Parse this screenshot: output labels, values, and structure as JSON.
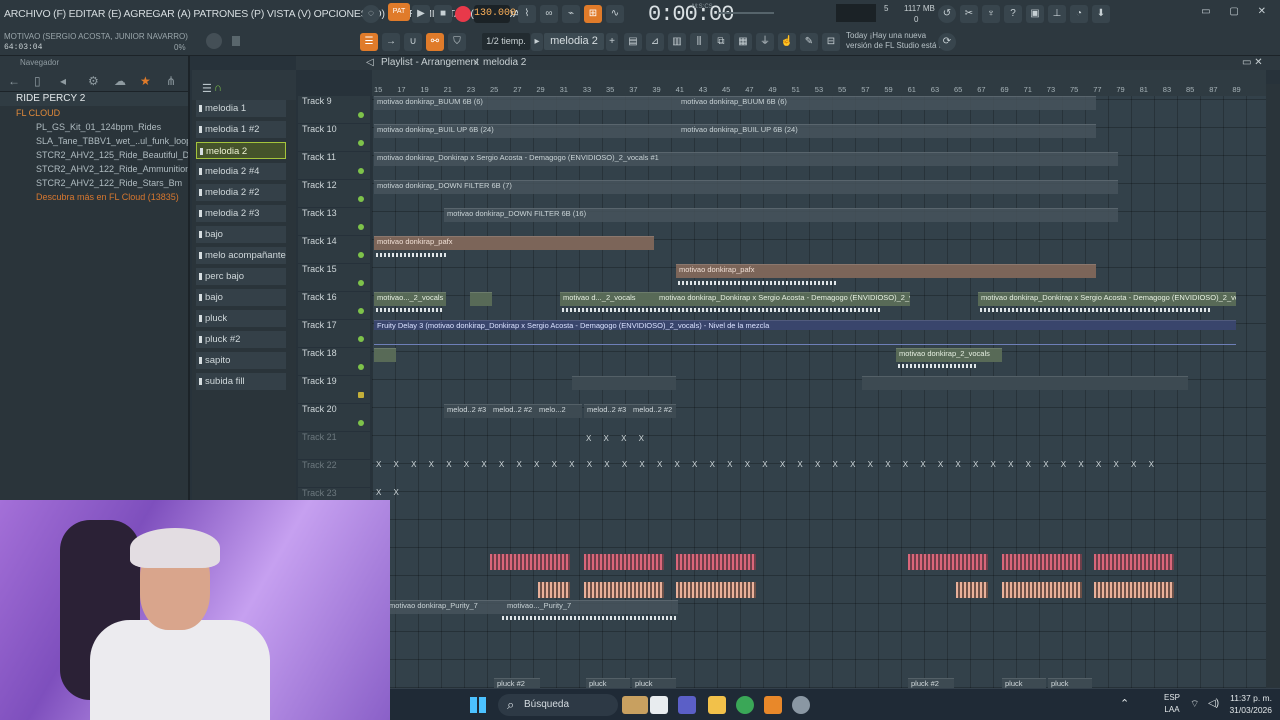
{
  "menu": {
    "items": "ARCHIVO (F) EDITAR (E) AGREGAR (A) PATRONES (P) VISTA (V) OPCIONES (O) HERRAMIENTAS (T) AYUDA"
  },
  "hint": "MOTIVAO (SERGIO ACOSTA, JUNIOR NAVARRO)",
  "position": "64:03:04",
  "percent": "0%",
  "transport": {
    "pat_label": "PAT",
    "bpm": "130.000",
    "clock": "0:00:00",
    "clock_unit": "M:S:CS"
  },
  "cpu": {
    "a": "5",
    "b": "1117 MB",
    "c": "0"
  },
  "toolbar": {
    "snap": "1/2 tiemp.",
    "pattern": "melodia 2"
  },
  "news": {
    "line1": "Today ¡Hay una nueva",
    "line2": "versión de FL Studio está d..."
  },
  "browser": {
    "title": "Navegador",
    "items": [
      {
        "label": "RIDE PERCY 2",
        "kind": "top"
      },
      {
        "label": "FL CLOUD",
        "kind": "folder"
      },
      {
        "label": "PL_GS_Kit_01_124bpm_Rides",
        "kind": "item"
      },
      {
        "label": "SLA_Tane_TBBV1_wet_..ul_funk_loop_riding",
        "kind": "item"
      },
      {
        "label": "STCR2_AHV2_125_Ride_Beautiful_D#m",
        "kind": "item"
      },
      {
        "label": "STCR2_AHV2_122_Ride_Ammunition_Cm",
        "kind": "item"
      },
      {
        "label": "STCR2_AHV2_122_Ride_Stars_Bm",
        "kind": "item"
      },
      {
        "label": "Descubra más en FL Cloud (13835)",
        "kind": "orange"
      }
    ]
  },
  "channels": [
    "melodia 1",
    "melodia 1 #2",
    "melodia 2",
    "melodia 2 #4",
    "melodia 2 #2",
    "melodia 2 #3",
    "bajo",
    "melo acompañante",
    "perc bajo",
    "bajo",
    "pluck",
    "pluck #2",
    "sapito",
    "subida fill"
  ],
  "playlist": {
    "title": "Playlist - Arrangement",
    "sep": "›",
    "pattern": "melodia 2"
  },
  "ruler": [
    "15",
    "17",
    "19",
    "21",
    "23",
    "25",
    "27",
    "29",
    "31",
    "33",
    "35",
    "37",
    "39",
    "41",
    "43",
    "45",
    "47",
    "49",
    "51",
    "53",
    "55",
    "57",
    "59",
    "61",
    "63",
    "65",
    "67",
    "69",
    "71",
    "73",
    "75",
    "77",
    "79",
    "81",
    "83",
    "85",
    "87",
    "89"
  ],
  "tracks": [
    "Track 9",
    "Track 10",
    "Track 11",
    "Track 12",
    "Track 13",
    "Track 14",
    "Track 15",
    "Track 16",
    "Track 17",
    "Track 18",
    "Track 19",
    "Track 20",
    "Track 21",
    "Track 22",
    "Track 23"
  ],
  "clips": {
    "c1": "motivao donkirap_BUUM 6B (6)",
    "c2": "motivao donkirap_BUUM 6B (6)",
    "c3": "motivao donkirap_BUIL UP 6B (24)",
    "c4": "motivao donkirap_BUIL UP 6B (24)",
    "c5": "motivao donkirap_Donkirap x Sergio Acosta - Demagogo (ENVIDIOSO)_2_vocals #1",
    "c6": "motivao donkirap_DOWN FILTER 6B (7)",
    "c7": "motivao donkirap_DOWN FILTER 6B (16)",
    "c8": "motivao donkirap_pafx",
    "c9": "motivao donkirap_pafx",
    "c10": "motivao..._2_vocals",
    "c11": "motivao d..._2_vocals",
    "c12": "motivao donkirap_Donkirap x Sergio Acosta - Demagogo (ENVIDIOSO)_2_vocals",
    "c13": "motivao donkirap_Donkirap x Sergio Acosta - Demagogo (ENVIDIOSO)_2_vocals",
    "c14": "Fruity Delay 3 (motivao donkirap_Donkirap x Sergio Acosta - Demagogo (ENVIDIOSO)_2_vocals) - Nivel de la mezcla",
    "c15": "motivao donkirap_2_vocals",
    "c16": "melod..2 #3",
    "c17": "melod..2 #2",
    "c18": "melo...2",
    "c19": "melod..2 #3",
    "c20": "melod..2 #2",
    "c21": "motivao donkirap_Purity_7",
    "c22": "motivao..._Purity_7",
    "c23": "pluck #2",
    "c24": "pluck",
    "c25": "pluck",
    "c26": "pluck #2",
    "c27": "pluck",
    "c28": "pluck"
  },
  "taskbar": {
    "search": "Búsqueda",
    "lang1": "ESP",
    "lang2": "LAA",
    "time": "11:37 p. m.",
    "date": "31/03/2026"
  }
}
